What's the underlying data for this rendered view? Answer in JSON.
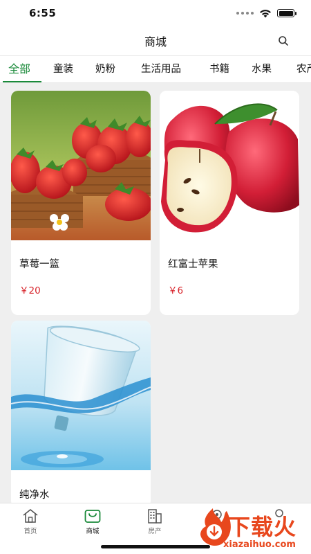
{
  "status_bar": {
    "time": "6:55"
  },
  "nav": {
    "title": "商城"
  },
  "tabs": [
    {
      "label": "全部",
      "active": true
    },
    {
      "label": "童装"
    },
    {
      "label": "奶粉"
    },
    {
      "label": "生活用品"
    },
    {
      "label": "书籍"
    },
    {
      "label": "水果"
    },
    {
      "label": "农产品"
    }
  ],
  "products": [
    {
      "name": "草莓一篮",
      "price": "￥20",
      "image": "strawberry-basket"
    },
    {
      "name": "红富士苹果",
      "price": "￥6",
      "image": "red-apples"
    },
    {
      "name": "纯净水",
      "price": "",
      "image": "water-bottle"
    }
  ],
  "tabbar": [
    {
      "label": "首页",
      "icon": "home-icon"
    },
    {
      "label": "商城",
      "icon": "shop-bag-icon",
      "active": true
    },
    {
      "label": "房产",
      "icon": "building-icon"
    },
    {
      "label": "",
      "icon": "location-icon"
    },
    {
      "label": "",
      "icon": "user-icon"
    }
  ],
  "watermark": {
    "text": "下载火",
    "url": "xiazaihuo.com"
  },
  "colors": {
    "accent": "#1a8a3a",
    "price": "#d8232a",
    "background": "#efefef"
  }
}
